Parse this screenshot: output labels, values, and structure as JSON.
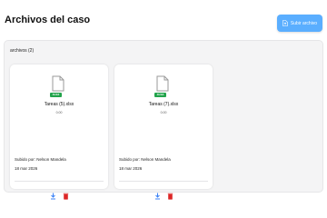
{
  "header": {
    "title": "Archivos del caso",
    "upload_label": "Subir archivo"
  },
  "section": {
    "label": "archivos (2)"
  },
  "files": [
    {
      "badge": "XLSX",
      "name": "Tareas (5).xlsx",
      "size": "0.00",
      "uploaded_by": "Subido por: Nelson Mandela",
      "date": "18 mar 2026"
    },
    {
      "badge": "XLSX",
      "name": "Tareas (7).xlsx",
      "size": "0.00",
      "uploaded_by": "Subido por: Nelson Mandela",
      "date": "18 mar 2026"
    }
  ],
  "colors": {
    "accent": "#5aaeff",
    "badge": "#22a34b",
    "download": "#3b82f6",
    "delete": "#dc2626"
  }
}
